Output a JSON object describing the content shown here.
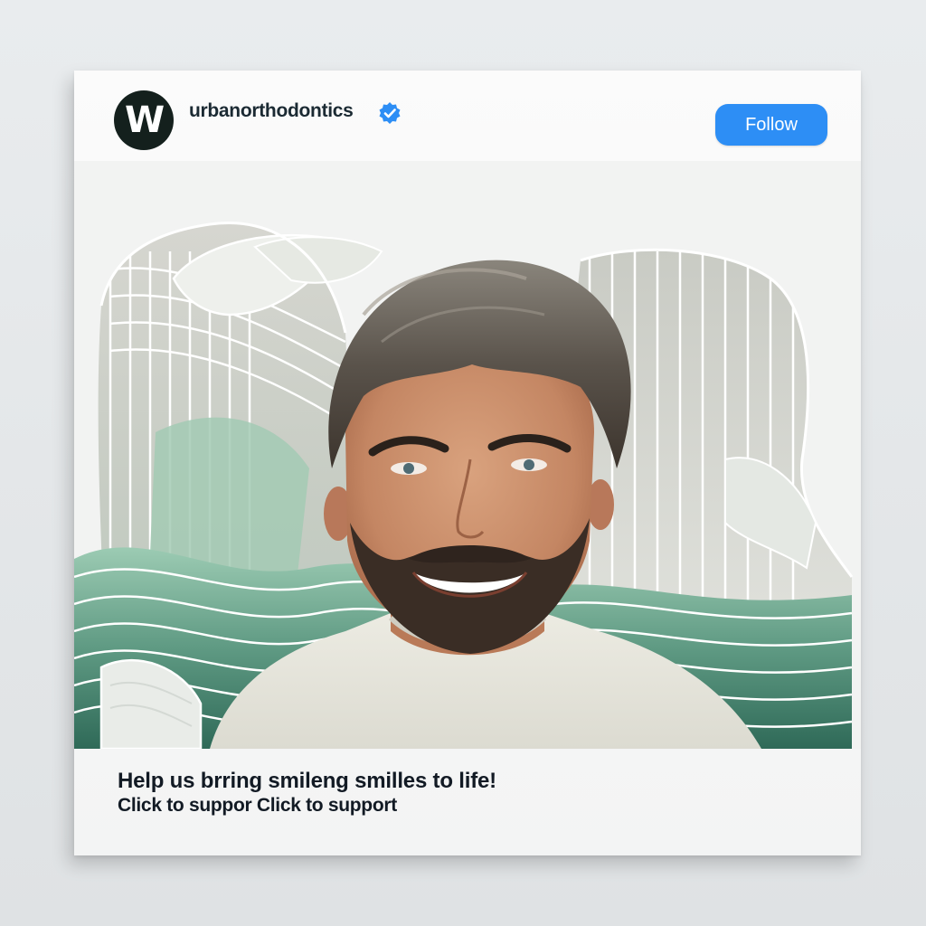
{
  "post": {
    "username": "urbanorthodontics",
    "verified": true,
    "avatar_letter": "W",
    "follow_label": "Follow",
    "caption_line1": "Help us brring smileng smilles to life!",
    "caption_line2": "Click to suppor Click to support"
  },
  "colors": {
    "follow_button": "#2d8ef5",
    "avatar_bg": "#14201d",
    "wave_light": "#9ccbb3",
    "wave_dark": "#2f6a58",
    "verified_badge": "#2d8ef5"
  },
  "icons": {
    "verified": "verified-badge-icon"
  }
}
